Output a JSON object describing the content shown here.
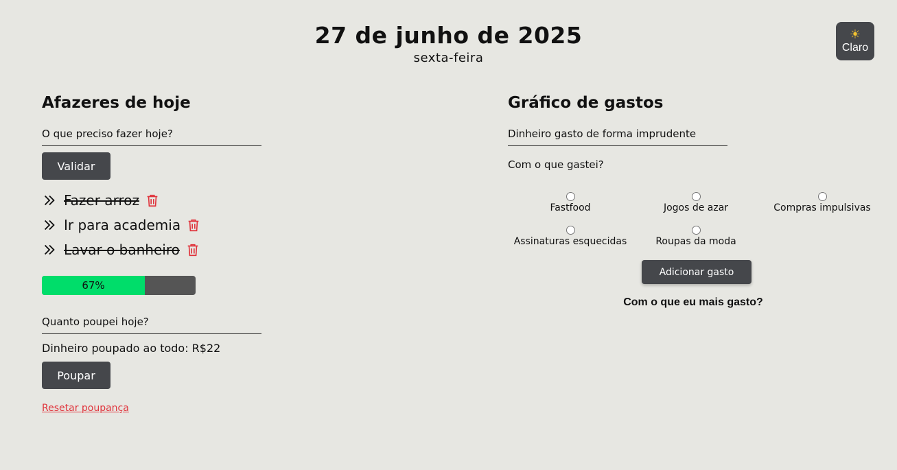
{
  "header": {
    "date": "27 de junho de 2025",
    "weekday": "sexta-feira"
  },
  "theme_toggle": {
    "icon": "sun-icon",
    "label": "Claro"
  },
  "todos": {
    "title": "Afazeres de hoje",
    "input_placeholder": "O que preciso fazer hoje?",
    "validate_label": "Validar",
    "items": [
      {
        "text": "Fazer arroz",
        "done": true
      },
      {
        "text": "Ir para academia",
        "done": false
      },
      {
        "text": "Lavar o banheiro",
        "done": true
      }
    ],
    "progress_percent": 67,
    "progress_label": "67%"
  },
  "savings": {
    "input_placeholder": "Quanto poupei hoje?",
    "total_label": "Dinheiro poupado ao todo: R$22",
    "save_label": "Poupar",
    "reset_label": "Resetar poupança"
  },
  "expenses": {
    "title": "Gráfico de gastos",
    "input_placeholder": "Dinheiro gasto de forma imprudente",
    "question": "Com o que gastei?",
    "options": [
      "Fastfood",
      "Jogos de azar",
      "Compras impulsivas",
      "Assinaturas esquecidas",
      "Roupas da moda"
    ],
    "add_label": "Adicionar gasto",
    "most_spent_title": "Com o que eu mais gasto?"
  },
  "colors": {
    "background": "#e7e7e2",
    "button": "#45474b",
    "progress_fill": "#00dd6a",
    "progress_track": "#555555",
    "danger": "#e0343c"
  }
}
